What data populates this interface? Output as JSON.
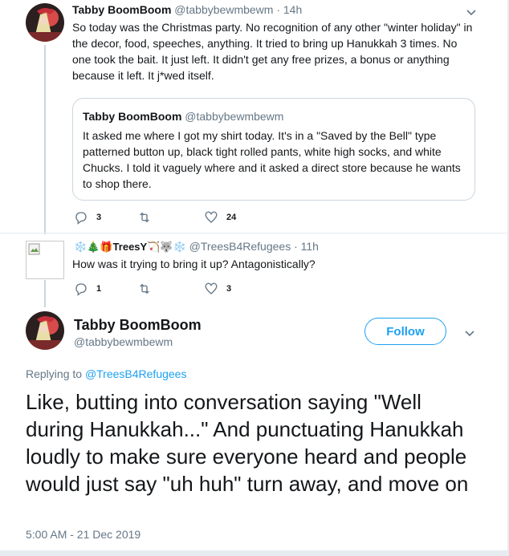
{
  "tweet1": {
    "name": "Tabby BoomBoom",
    "handle": "@tabbybewmbewm",
    "time": "· 14h",
    "text": "So today was the Christmas party. No recognition of any other \"winter holiday\" in the decor, food, speeches, anything. It tried to bring up Hanukkah 3 times. No one took the bait. It just left. It didn't get any free prizes, a bonus or anything because it left. It j*wed itself.",
    "quote": {
      "name": "Tabby BoomBoom",
      "handle": "@tabbybewmbewm",
      "text": "It asked me where I got my shirt today. It's in a \"Saved by the Bell\" type patterned button up, black tight rolled pants, white high socks, and white Chucks. I told it vaguely where and it asked a direct store because he wants to shop there."
    },
    "replies": "3",
    "retweets": "",
    "likes": "24"
  },
  "tweet2": {
    "name": "❄️🎄🎁TreesY🏹🐺❄️",
    "handle": "@TreesB4Refugees",
    "time": "· 11h",
    "text": "How was it trying to bring it up? Antagonistically?",
    "replies": "1",
    "retweets": "",
    "likes": "3"
  },
  "main": {
    "name": "Tabby BoomBoom",
    "handle": "@tabbybewmbewm",
    "follow_label": "Follow",
    "replying_prefix": "Replying to",
    "replying_to": "@TreesB4Refugees",
    "text": "Like, butting into conversation saying \"Well during Hanukkah...\" And punctuating Hanukkah loudly to make sure everyone heard and people would just say \"uh huh\" turn away, and move on",
    "timestamp": "5:00 AM - 21 Dec 2019"
  },
  "colors": {
    "accent": "#1da1f2",
    "secondary_text": "#657786",
    "border": "#ccd6dd"
  }
}
